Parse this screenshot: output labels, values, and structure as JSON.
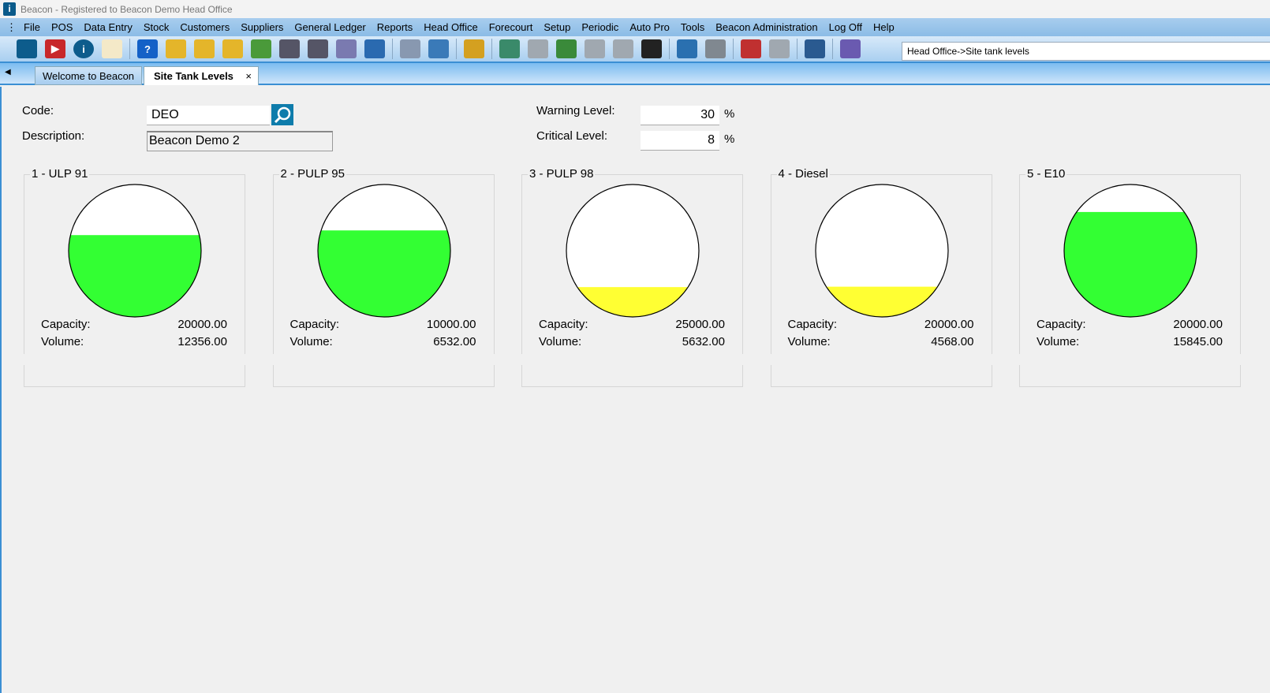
{
  "window": {
    "title": "Beacon - Registered to Beacon Demo Head Office"
  },
  "menu": [
    "File",
    "POS",
    "Data Entry",
    "Stock",
    "Customers",
    "Suppliers",
    "General Ledger",
    "Reports",
    "Head Office",
    "Forecourt",
    "Setup",
    "Periodic",
    "Auto Pro",
    "Tools",
    "Beacon Administration",
    "Log Off",
    "Help"
  ],
  "toolbar": {
    "icons": [
      "home-icon",
      "youtube-icon",
      "info-icon",
      "mail-icon",
      "help-icon",
      "stock-transfer-icon",
      "pdt-icon",
      "database-sync-icon",
      "add-list-icon",
      "pump-icon",
      "device-usb-icon",
      "checklist-icon",
      "tree-icon",
      "document-icon",
      "car-icon",
      "link-doc-icon",
      "map-icon",
      "chart-bar-icon",
      "spreadsheet-edit-icon",
      "report-icon",
      "excel-icon",
      "line-chart-icon",
      "globe-icon",
      "tag-icon",
      "calendar-icon",
      "eye-icon",
      "calculator-icon",
      "exit-door-icon"
    ],
    "breadcrumb": "Head Office->Site tank levels"
  },
  "tabs": [
    {
      "label": "Welcome to Beacon"
    },
    {
      "label": "Site Tank Levels",
      "close": "×"
    }
  ],
  "form": {
    "code_label": "Code:",
    "code_value": "DEO",
    "description_label": "Description:",
    "description_value": "Beacon Demo 2",
    "warning_label": "Warning Level:",
    "warning_value": "30",
    "critical_label": "Critical Level:",
    "critical_value": "8",
    "percent": "%"
  },
  "tank_labels": {
    "capacity": "Capacity:",
    "volume": "Volume:"
  },
  "colors": {
    "ok": "#33ff33",
    "warning": "#ffff33",
    "empty": "#ffffff"
  },
  "tanks": [
    {
      "title": "1 - ULP 91",
      "capacity": "20000.00",
      "volume": "12356.00",
      "level": 0.6178,
      "status": "ok"
    },
    {
      "title": "2 - PULP 95",
      "capacity": "10000.00",
      "volume": "6532.00",
      "level": 0.6532,
      "status": "ok"
    },
    {
      "title": "3 - PULP 98",
      "capacity": "25000.00",
      "volume": "5632.00",
      "level": 0.2253,
      "status": "warning"
    },
    {
      "title": "4 - Diesel",
      "capacity": "20000.00",
      "volume": "4568.00",
      "level": 0.2284,
      "status": "warning"
    },
    {
      "title": "5 - E10",
      "capacity": "20000.00",
      "volume": "15845.00",
      "level": 0.7923,
      "status": "ok"
    }
  ]
}
